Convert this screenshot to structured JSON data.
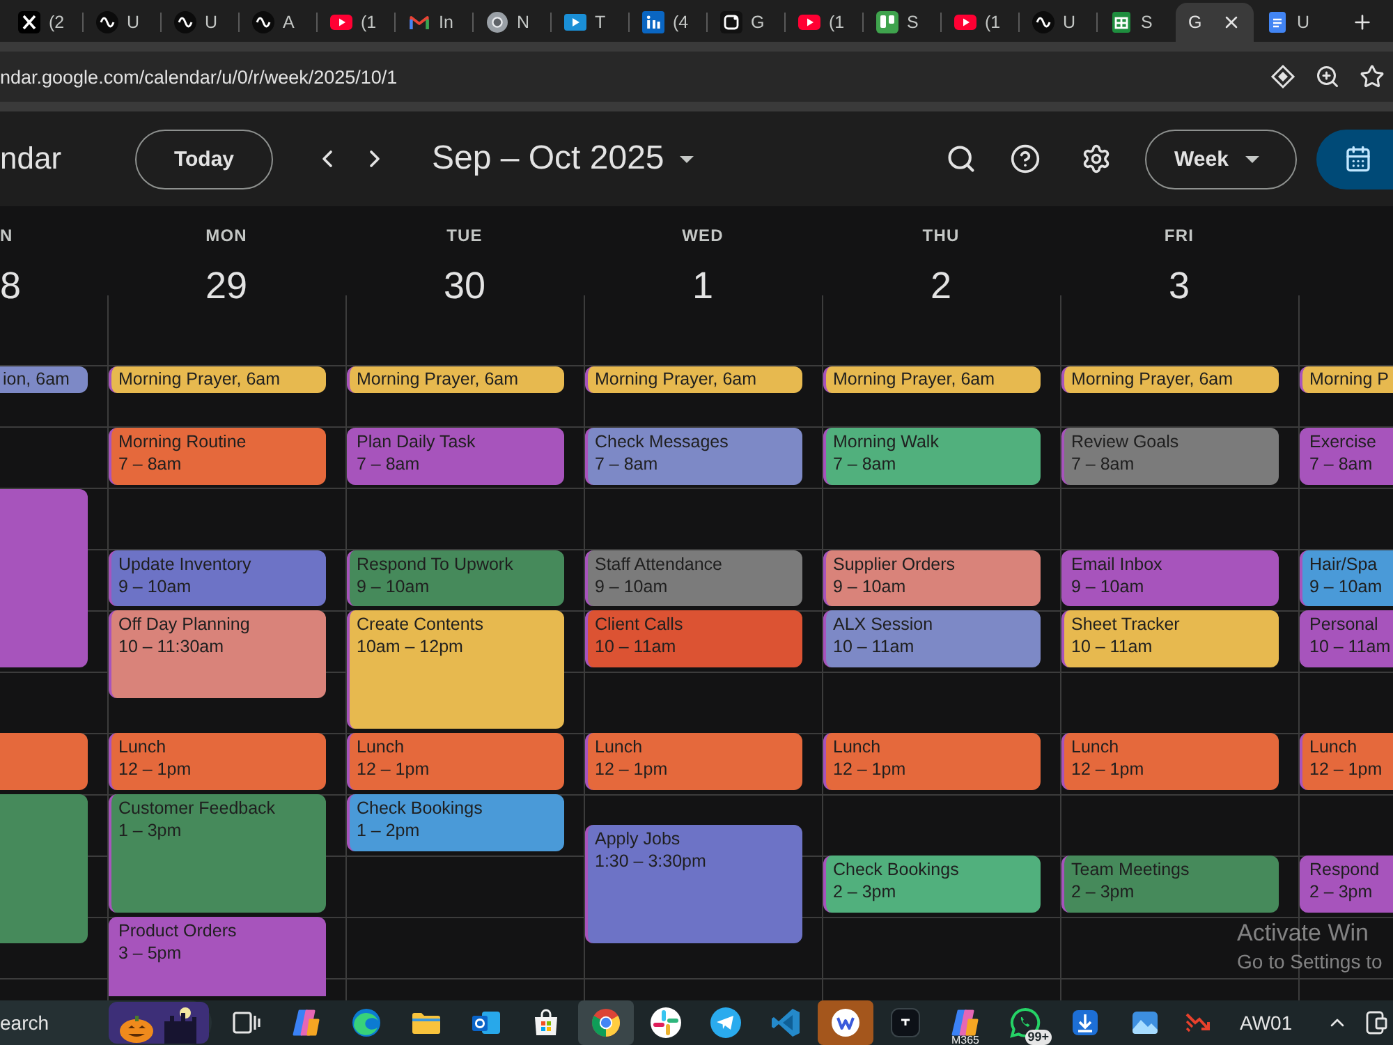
{
  "browser": {
    "tabs": [
      {
        "kind": "x",
        "title": "(2",
        "selected": false
      },
      {
        "kind": "upwork",
        "title": "U",
        "selected": false
      },
      {
        "kind": "upwork",
        "title": "U",
        "selected": false
      },
      {
        "kind": "upwork",
        "title": "A",
        "selected": false
      },
      {
        "kind": "youtube",
        "title": "(1",
        "selected": false
      },
      {
        "kind": "gmail",
        "title": "In",
        "selected": false
      },
      {
        "kind": "chrome",
        "title": "N",
        "selected": false
      },
      {
        "kind": "video",
        "title": "T",
        "selected": false
      },
      {
        "kind": "linkedin",
        "title": "(4",
        "selected": false
      },
      {
        "kind": "square-g",
        "title": "G",
        "selected": false
      },
      {
        "kind": "youtube",
        "title": "(1",
        "selected": false
      },
      {
        "kind": "trello",
        "title": "S",
        "selected": false
      },
      {
        "kind": "youtube",
        "title": "(1",
        "selected": false
      },
      {
        "kind": "upwork",
        "title": "U",
        "selected": false
      },
      {
        "kind": "sheets",
        "title": "S",
        "selected": false
      },
      {
        "kind": "none",
        "title": "G",
        "selected": true
      },
      {
        "kind": "docs",
        "title": "U",
        "selected": false
      }
    ],
    "address": {
      "url": "ndar.google.com/calendar/u/0/r/week/2025/10/1"
    }
  },
  "calendar": {
    "app_title": "ndar",
    "today_button": "Today",
    "date_range": "Sep – Oct 2025",
    "view_button": "Week",
    "days": [
      {
        "name": "N",
        "date": "8",
        "slots": [
          {
            "kind": "empty"
          },
          {
            "kind": "empty"
          },
          {
            "kind": "chip",
            "title": "ion, 6am",
            "color": "#7d89c6"
          },
          {
            "kind": "empty"
          },
          {
            "kind": "empty"
          },
          {
            "kind": "empty"
          },
          {
            "kind": "event",
            "color": "#a754bc"
          },
          {
            "kind": "continued"
          },
          {
            "kind": "continued"
          },
          {
            "kind": "continued"
          },
          {
            "kind": "continued"
          },
          {
            "kind": "continued"
          },
          {
            "kind": "empty"
          },
          {
            "kind": "empty"
          },
          {
            "kind": "event",
            "color": "#e5693c"
          },
          {
            "kind": "continued"
          },
          {
            "kind": "event",
            "color": "#468a5b"
          },
          {
            "kind": "continued"
          },
          {
            "kind": "continued"
          },
          {
            "kind": "continued"
          },
          {
            "kind": "continued"
          }
        ]
      },
      {
        "name": "MON",
        "date": "29",
        "slots": [
          {
            "kind": "empty"
          },
          {
            "kind": "empty"
          },
          {
            "kind": "chip",
            "title": "Morning Prayer, 6am",
            "color": "#e7b94f"
          },
          {
            "kind": "empty"
          },
          {
            "kind": "event",
            "title": "Morning Routine",
            "time": "7 – 8am",
            "color": "#e5693c"
          },
          {
            "kind": "continued"
          },
          {
            "kind": "empty"
          },
          {
            "kind": "empty"
          },
          {
            "kind": "event",
            "title": "Update Inventory",
            "time": "9 – 10am",
            "color": "#6d73c6"
          },
          {
            "kind": "continued"
          },
          {
            "kind": "event",
            "title": "Off Day Planning",
            "time": "10 – 11:30am",
            "color": "#d9837a"
          },
          {
            "kind": "continued"
          },
          {
            "kind": "continued"
          },
          {
            "kind": "empty"
          },
          {
            "kind": "event",
            "title": "Lunch",
            "time": "12 – 1pm",
            "color": "#e5693c"
          },
          {
            "kind": "continued"
          },
          {
            "kind": "event",
            "title": "Customer Feedback",
            "time": "1 – 3pm",
            "color": "#468a5b"
          },
          {
            "kind": "continued"
          },
          {
            "kind": "continued"
          },
          {
            "kind": "continued"
          },
          {
            "kind": "event",
            "title": "Product Orders",
            "time": "3 – 5pm",
            "color": "#a754bc"
          },
          {
            "kind": "continued"
          },
          {
            "kind": "continued"
          }
        ]
      },
      {
        "name": "TUE",
        "date": "30",
        "slots": [
          {
            "kind": "empty"
          },
          {
            "kind": "empty"
          },
          {
            "kind": "chip",
            "title": "Morning Prayer, 6am",
            "color": "#e7b94f"
          },
          {
            "kind": "empty"
          },
          {
            "kind": "event",
            "title": "Plan Daily Task",
            "time": "7 – 8am",
            "color": "#a754bc"
          },
          {
            "kind": "continued"
          },
          {
            "kind": "empty"
          },
          {
            "kind": "empty"
          },
          {
            "kind": "event",
            "title": "Respond To Upwork",
            "time": "9 – 10am",
            "color": "#468a5b"
          },
          {
            "kind": "continued"
          },
          {
            "kind": "event",
            "title": "Create Contents",
            "time": "10am – 12pm",
            "color": "#e7b94f"
          },
          {
            "kind": "continued"
          },
          {
            "kind": "continued"
          },
          {
            "kind": "continued"
          },
          {
            "kind": "event",
            "title": "Lunch",
            "time": "12 – 1pm",
            "color": "#e5693c"
          },
          {
            "kind": "continued"
          },
          {
            "kind": "event",
            "title": "Check Bookings",
            "time": "1 – 2pm",
            "color": "#4a9ad8"
          },
          {
            "kind": "continued"
          }
        ]
      },
      {
        "name": "WED",
        "date": "1",
        "slots": [
          {
            "kind": "empty"
          },
          {
            "kind": "empty"
          },
          {
            "kind": "chip",
            "title": "Morning Prayer, 6am",
            "color": "#e7b94f"
          },
          {
            "kind": "empty"
          },
          {
            "kind": "event",
            "title": "Check Messages",
            "time": "7 – 8am",
            "color": "#7d89c6"
          },
          {
            "kind": "continued"
          },
          {
            "kind": "empty"
          },
          {
            "kind": "empty"
          },
          {
            "kind": "event",
            "title": "Staff Attendance",
            "time": "9 – 10am",
            "color": "#7b7b7b"
          },
          {
            "kind": "continued"
          },
          {
            "kind": "event",
            "title": "Client Calls",
            "time": "10 – 11am",
            "color": "#dc5333"
          },
          {
            "kind": "continued"
          },
          {
            "kind": "empty"
          },
          {
            "kind": "empty"
          },
          {
            "kind": "event",
            "title": "Lunch",
            "time": "12 – 1pm",
            "color": "#e5693c"
          },
          {
            "kind": "continued"
          },
          {
            "kind": "empty"
          },
          {
            "kind": "event",
            "title": "Apply Jobs",
            "time": "1:30 – 3:30pm",
            "color": "#6d73c6"
          },
          {
            "kind": "continued"
          },
          {
            "kind": "continued"
          },
          {
            "kind": "continued"
          }
        ]
      },
      {
        "name": "THU",
        "date": "2",
        "slots": [
          {
            "kind": "empty"
          },
          {
            "kind": "empty"
          },
          {
            "kind": "chip",
            "title": "Morning Prayer, 6am",
            "color": "#e7b94f"
          },
          {
            "kind": "empty"
          },
          {
            "kind": "event",
            "title": "Morning Walk",
            "time": "7 – 8am",
            "color": "#51b07d"
          },
          {
            "kind": "continued"
          },
          {
            "kind": "empty"
          },
          {
            "kind": "empty"
          },
          {
            "kind": "event",
            "title": "Supplier Orders",
            "time": "9 – 10am",
            "color": "#d9837a"
          },
          {
            "kind": "continued"
          },
          {
            "kind": "event",
            "title": "ALX Session",
            "time": "10 – 11am",
            "color": "#7d89c6"
          },
          {
            "kind": "continued"
          },
          {
            "kind": "empty"
          },
          {
            "kind": "empty"
          },
          {
            "kind": "event",
            "title": "Lunch",
            "time": "12 – 1pm",
            "color": "#e5693c"
          },
          {
            "kind": "continued"
          },
          {
            "kind": "empty"
          },
          {
            "kind": "empty"
          },
          {
            "kind": "event",
            "title": "Check Bookings",
            "time": "2 – 3pm",
            "color": "#51b07d"
          },
          {
            "kind": "continued"
          }
        ]
      },
      {
        "name": "FRI",
        "date": "3",
        "slots": [
          {
            "kind": "empty"
          },
          {
            "kind": "empty"
          },
          {
            "kind": "chip",
            "title": "Morning Prayer, 6am",
            "color": "#e7b94f"
          },
          {
            "kind": "empty"
          },
          {
            "kind": "event",
            "title": "Review Goals",
            "time": "7 – 8am",
            "color": "#7b7b7b"
          },
          {
            "kind": "continued"
          },
          {
            "kind": "empty"
          },
          {
            "kind": "empty"
          },
          {
            "kind": "event",
            "title": "Email Inbox",
            "time": "9 – 10am",
            "color": "#a754bc"
          },
          {
            "kind": "continued"
          },
          {
            "kind": "event",
            "title": "Sheet Tracker",
            "time": "10 – 11am",
            "color": "#e7b94f"
          },
          {
            "kind": "continued"
          },
          {
            "kind": "empty"
          },
          {
            "kind": "empty"
          },
          {
            "kind": "event",
            "title": "Lunch",
            "time": "12 – 1pm",
            "color": "#e5693c"
          },
          {
            "kind": "continued"
          },
          {
            "kind": "empty"
          },
          {
            "kind": "empty"
          },
          {
            "kind": "event",
            "title": "Team Meetings",
            "time": "2 – 3pm",
            "color": "#468a5b"
          },
          {
            "kind": "continued"
          }
        ]
      },
      {
        "slots": [
          {
            "kind": "empty"
          },
          {
            "kind": "empty"
          },
          {
            "kind": "chip",
            "title": "Morning P",
            "color": "#e7b94f"
          },
          {
            "kind": "empty"
          },
          {
            "kind": "event",
            "title": "Exercise",
            "time": "7 – 8am",
            "color": "#a754bc"
          },
          {
            "kind": "continued"
          },
          {
            "kind": "empty"
          },
          {
            "kind": "empty"
          },
          {
            "kind": "event",
            "title": "Hair/Spa",
            "time": "9 – 10am",
            "color": "#4a9ad8"
          },
          {
            "kind": "continued"
          },
          {
            "kind": "event",
            "title": "Personal",
            "time": "10 – 11am",
            "color": "#a754bc"
          },
          {
            "kind": "continued"
          },
          {
            "kind": "empty"
          },
          {
            "kind": "empty"
          },
          {
            "kind": "event",
            "title": "Lunch",
            "time": "12 – 1pm",
            "color": "#e5693c"
          },
          {
            "kind": "continued"
          },
          {
            "kind": "empty"
          },
          {
            "kind": "empty"
          },
          {
            "kind": "event",
            "title": "Respond",
            "time": "2 – 3pm",
            "color": "#a754bc"
          },
          {
            "kind": "continued"
          }
        ]
      }
    ]
  },
  "activation_notice": {
    "title": "Activate Win",
    "text": "Go to Settings to"
  },
  "taskbar": {
    "search": {
      "placeholder": "earch"
    },
    "apps": [
      {
        "kind": "task-view",
        "selected": false,
        "attention": false
      },
      {
        "kind": "copilot",
        "selected": false,
        "attention": false
      },
      {
        "kind": "edge",
        "selected": false,
        "attention": false
      },
      {
        "kind": "explorer",
        "selected": false,
        "attention": false
      },
      {
        "kind": "outlook",
        "selected": false,
        "attention": false
      },
      {
        "kind": "store",
        "selected": false,
        "attention": false
      },
      {
        "kind": "chrome",
        "selected": true,
        "attention": false
      },
      {
        "kind": "slack",
        "selected": false,
        "attention": false
      },
      {
        "kind": "telegram",
        "selected": false,
        "attention": false
      },
      {
        "kind": "vscode",
        "selected": false,
        "attention": false
      },
      {
        "kind": "w-app",
        "selected": false,
        "attention": true
      },
      {
        "kind": "dark-app",
        "selected": false,
        "attention": false
      },
      {
        "kind": "m365",
        "caption": "M365",
        "selected": false,
        "attention": false
      },
      {
        "kind": "whatsapp",
        "badge": "99+",
        "selected": false,
        "attention": false
      },
      {
        "kind": "download",
        "selected": false,
        "attention": false
      },
      {
        "kind": "photos",
        "selected": false,
        "attention": false
      }
    ],
    "tray_label": "AW01"
  }
}
